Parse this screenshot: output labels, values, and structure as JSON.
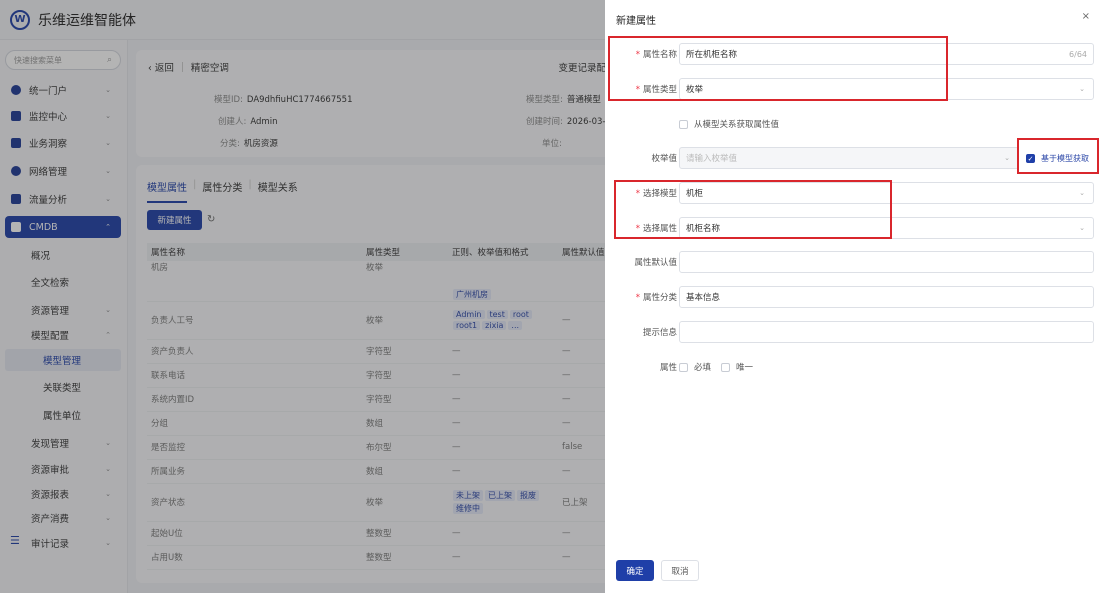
{
  "app": {
    "logo_letter": "W",
    "title": "乐维运维智能体"
  },
  "sidebar": {
    "search_placeholder": "快速搜索菜单",
    "items": [
      {
        "label": "统一门户"
      },
      {
        "label": "监控中心"
      },
      {
        "label": "业务洞察"
      },
      {
        "label": "网络管理"
      },
      {
        "label": "流量分析"
      },
      {
        "label": "CMDB"
      },
      {
        "label": "概况"
      },
      {
        "label": "全文检索"
      },
      {
        "label": "资源管理"
      },
      {
        "label": "模型配置"
      },
      {
        "label": "模型管理"
      },
      {
        "label": "关联类型"
      },
      {
        "label": "属性单位"
      },
      {
        "label": "发现管理"
      },
      {
        "label": "资源审批"
      },
      {
        "label": "资源报表"
      },
      {
        "label": "资产消费"
      },
      {
        "label": "审计记录"
      }
    ]
  },
  "model": {
    "back_label": "返回",
    "name": "精密空调",
    "changes_label": "变更记录配",
    "model_id_label": "模型ID:",
    "model_id": "DA9dhfiuHC1774667551",
    "creator_label": "创建人:",
    "creator": "Admin",
    "category_label": "分类:",
    "category": "机房资源",
    "model_type_label": "模型类型:",
    "model_type": "普通模型",
    "created_time_label": "创建时间:",
    "created_time": "2026-03-",
    "unit_label": "单位:"
  },
  "tabs": [
    "模型属性",
    "属性分类",
    "模型关系"
  ],
  "toolbar": {
    "new_attr_label": "新建属性"
  },
  "table": {
    "headers": [
      "属性名称",
      "属性类型",
      "正则、枚举值和格式",
      "属性默认值"
    ],
    "rows": [
      {
        "name": "机房",
        "type": "枚举",
        "tags": [
          "广州机房"
        ],
        "default": ""
      },
      {
        "name": "负责人工号",
        "type": "枚举",
        "tags": [
          "Admin",
          "test",
          "root",
          "root1",
          "zixia",
          "..."
        ],
        "default": "—"
      },
      {
        "name": "资产负责人",
        "type": "字符型",
        "tags": [],
        "regex": "—",
        "default": "—"
      },
      {
        "name": "联系电话",
        "type": "字符型",
        "tags": [],
        "regex": "—",
        "default": "—"
      },
      {
        "name": "系统内置ID",
        "type": "字符型",
        "tags": [],
        "regex": "—",
        "default": "—"
      },
      {
        "name": "分组",
        "type": "数组",
        "tags": [],
        "regex": "—",
        "default": "—"
      },
      {
        "name": "是否监控",
        "type": "布尔型",
        "tags": [],
        "regex": "—",
        "default": "false"
      },
      {
        "name": "所属业务",
        "type": "数组",
        "tags": [],
        "regex": "—",
        "default": "—"
      },
      {
        "name": "资产状态",
        "type": "枚举",
        "tags": [
          "未上架",
          "已上架",
          "报废",
          "维修中"
        ],
        "default": "已上架"
      },
      {
        "name": "起始U位",
        "type": "整数型",
        "tags": [],
        "regex": "—",
        "default": "—"
      },
      {
        "name": "占用U数",
        "type": "整数型",
        "tags": [],
        "regex": "—",
        "default": "—"
      }
    ]
  },
  "drawer": {
    "title": "新建属性",
    "close": "×",
    "attr_name_label": "属性名称",
    "attr_name_value": "所在机柜名称",
    "attr_name_counter": "6/64",
    "attr_type_label": "属性类型",
    "attr_type_value": "枚举",
    "from_model_label": "从模型关系获取属性值",
    "enum_label": "枚举值",
    "enum_placeholder": "请输入枚举值",
    "based_on_model_label": "基于模型获取",
    "select_model_label": "选择模型",
    "select_model_value": "机柜",
    "select_attr_label": "选择属性",
    "select_attr_value": "机柜名称",
    "default_label": "属性默认值",
    "category_label": "属性分类",
    "category_value": "基本信息",
    "hint_label": "提示信息",
    "props_label": "属性",
    "required_label": "必填",
    "unique_label": "唯一",
    "ok_label": "确定",
    "cancel_label": "取消"
  }
}
